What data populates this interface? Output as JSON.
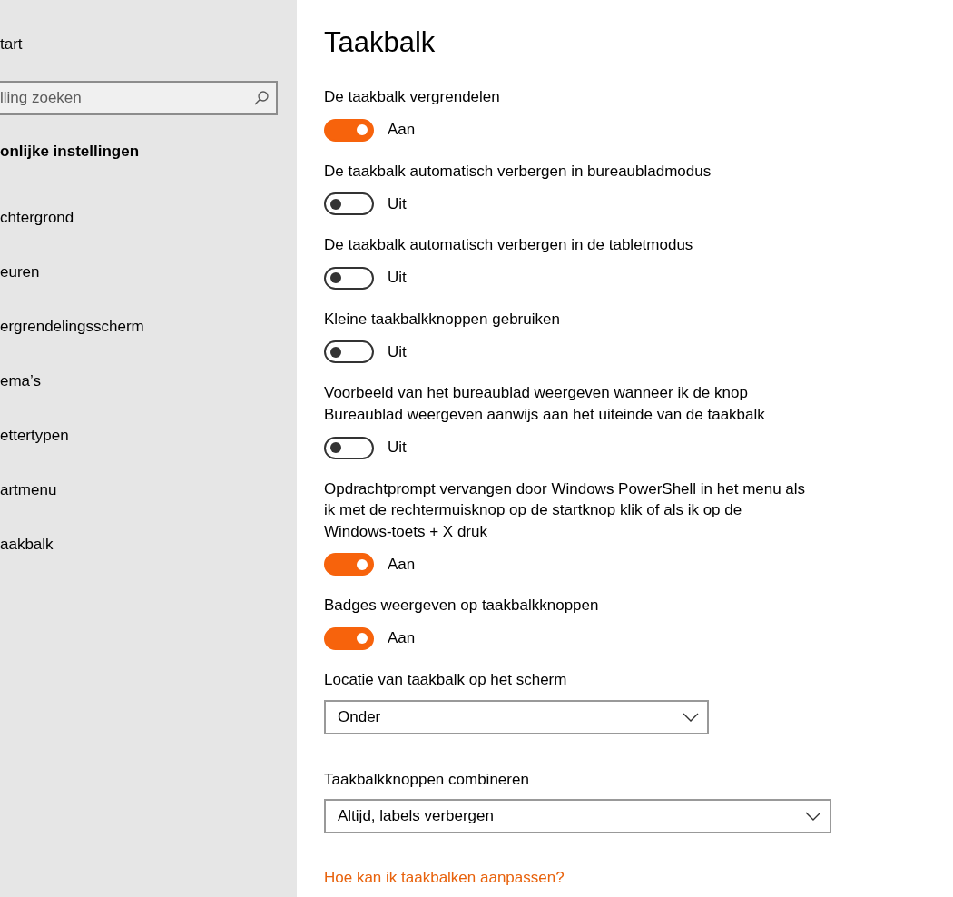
{
  "sidebar": {
    "nav_link": "tart",
    "search": {
      "placeholder": "lling zoeken"
    },
    "section_title": "onlijke instellingen",
    "items": [
      {
        "label": "chtergrond"
      },
      {
        "label": "euren"
      },
      {
        "label": "ergrendelingsscherm"
      },
      {
        "label": "ema’s"
      },
      {
        "label": "ettertypen"
      },
      {
        "label": "artmenu"
      },
      {
        "label": "aakbalk"
      }
    ]
  },
  "page": {
    "title": "Taakbalk",
    "settings": [
      {
        "kind": "toggle",
        "label": "De taakbalk vergrendelen",
        "on": true,
        "state_text": "Aan"
      },
      {
        "kind": "toggle",
        "label": "De taakbalk automatisch verbergen in bureaubladmodus",
        "on": false,
        "state_text": "Uit"
      },
      {
        "kind": "toggle",
        "label": "De taakbalk automatisch verbergen in de tabletmodus",
        "on": false,
        "state_text": "Uit"
      },
      {
        "kind": "toggle",
        "label": "Kleine taakbalkknoppen gebruiken",
        "on": false,
        "state_text": "Uit"
      },
      {
        "kind": "toggle",
        "label": "Voorbeeld van het bureaublad weergeven wanneer ik de knop Bureaublad weergeven aanwijs aan het uiteinde van de taakbalk",
        "on": false,
        "state_text": "Uit"
      },
      {
        "kind": "toggle",
        "label": "Opdrachtprompt vervangen door Windows PowerShell in het menu als ik met de rechtermuisknop op de startknop klik of als ik op de Windows-toets + X druk",
        "on": true,
        "state_text": "Aan"
      },
      {
        "kind": "toggle",
        "label": "Badges weergeven op taakbalkknoppen",
        "on": true,
        "state_text": "Aan"
      },
      {
        "kind": "dropdown",
        "label": "Locatie van taakbalk op het scherm",
        "value": "Onder"
      },
      {
        "kind": "dropdown",
        "label": "Taakbalkknoppen combineren",
        "value": "Altijd, labels verbergen"
      }
    ],
    "help_link": "Hoe kan ik taakbalken aanpassen?"
  }
}
